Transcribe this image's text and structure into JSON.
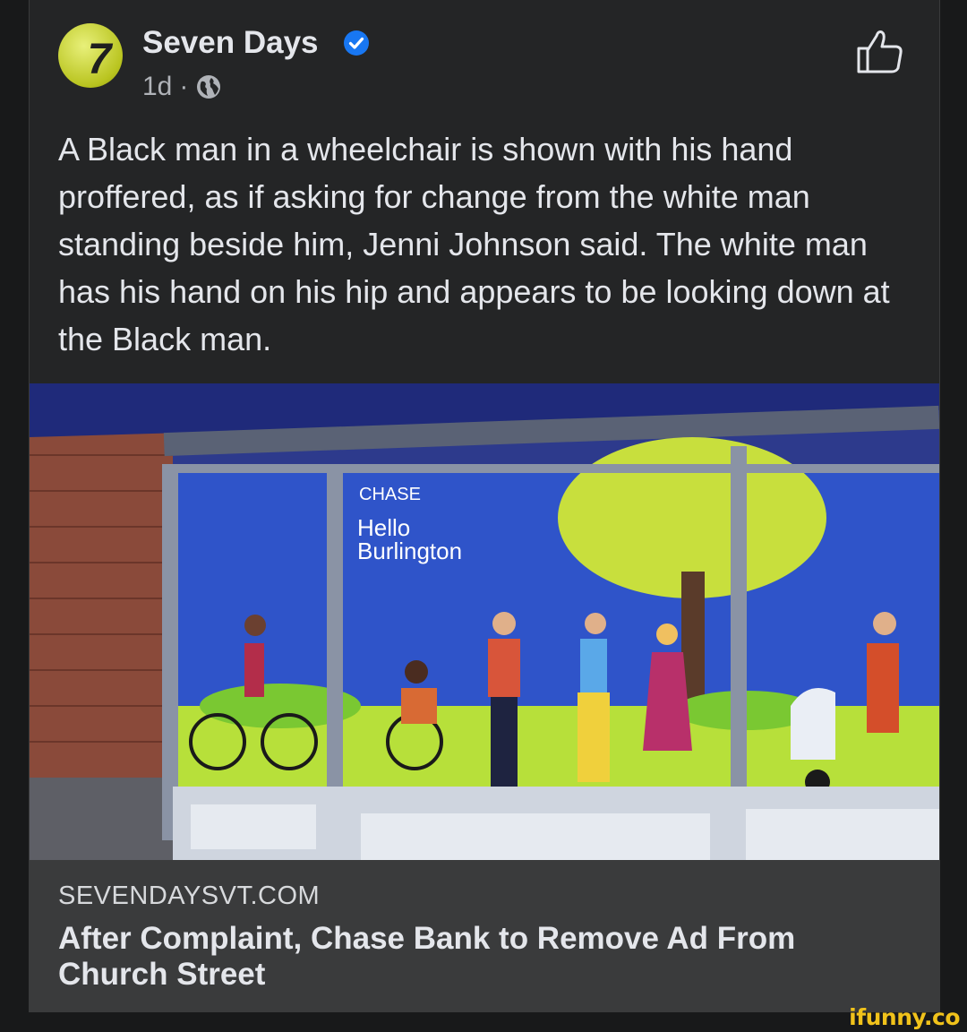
{
  "post": {
    "author": "Seven Days",
    "avatar_text": "7",
    "time": "1d",
    "separator": "·",
    "privacy_icon": "globe-icon",
    "verified_icon": "verified-badge-icon",
    "action_icon": "thumbs-up-icon",
    "text": "A Black man in a wheelchair is shown with his hand proffered, as if asking for change from the white man standing beside him, Jenni Johnson said. The white man has his hand on his hip and appears to be looking down at the Black man."
  },
  "photo": {
    "sign_brand": "CHASE",
    "sign_line1": "Hello",
    "sign_line2": "Burlington"
  },
  "link": {
    "domain": "SEVENDAYSVT.COM",
    "headline": "After Complaint, Chase Bank to Remove Ad From Church Street"
  },
  "watermark": "ifunny.co",
  "colors": {
    "background": "#18191a",
    "card": "#242526",
    "link_bar": "#3a3b3c",
    "verified": "#1877f2",
    "watermark": "#f0c21b"
  }
}
